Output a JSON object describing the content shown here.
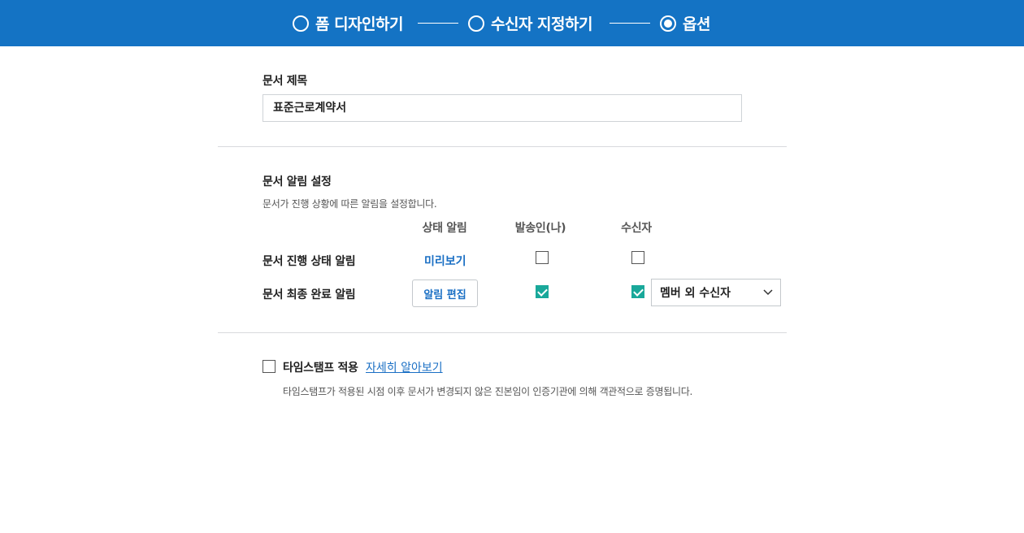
{
  "stepper": {
    "steps": [
      {
        "label": "폼 디자인하기",
        "active": false
      },
      {
        "label": "수신자 지정하기",
        "active": false
      },
      {
        "label": "옵션",
        "active": true
      }
    ]
  },
  "document_title": {
    "label": "문서 제목",
    "value": "표준근로계약서"
  },
  "notification": {
    "heading": "문서 알림 설정",
    "description": "문서가 진행 상황에 따른 알림을 설정합니다.",
    "columns": [
      "상태 알림",
      "발송인(나)",
      "수신자"
    ],
    "rows": [
      {
        "label": "문서 진행 상태 알림",
        "action": "미리보기",
        "sender_checked": false,
        "recipient_checked": false
      },
      {
        "label": "문서 최종 완료 알림",
        "action": "알림 편집",
        "sender_checked": true,
        "recipient_checked": true,
        "recipient_scope": "멤버 외 수신자"
      }
    ]
  },
  "timestamp": {
    "label": "타임스탬프 적용",
    "link": "자세히 알아보기",
    "checked": false,
    "description": "타임스탬프가 적용된 시점 이후 문서가 변경되지 않은 진본임이 인증기관에 의해 객관적으로 증명됩니다."
  },
  "colors": {
    "header_bg": "#1473c4",
    "accent_link": "#1a6fc4",
    "checkbox_checked": "#19a89a"
  }
}
